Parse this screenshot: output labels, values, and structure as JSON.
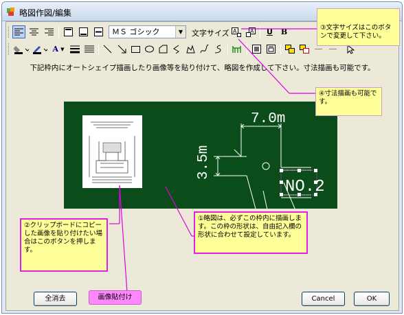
{
  "window": {
    "title": "略図作図/編集"
  },
  "toolbar": {
    "font_name": "ＭＳ ゴシック",
    "font_size_label": "文字サイズ",
    "underline_label": "U",
    "bold_label": "B",
    "text_color_label": "A"
  },
  "instruction": "下記枠内にオートシェイプ描画したり画像等を貼り付けて、略図を作成して下さい。寸法描画も可能です。",
  "canvas": {
    "dim_top": "7.0m",
    "dim_left": "3.5m",
    "no_label": "NO.2"
  },
  "notes": {
    "note1": "①略図は、必ずこの枠内に描画します。この枠の形状は、自由記入欄の形状に合わせて設定しています。",
    "note2": "②クリップボードにコピーした画像を貼り付けたい場合はこのボタンを押します。",
    "note3": "③文字サイズはこのボタンで変更して下さい。",
    "note4": "④寸法描画も可能です。"
  },
  "buttons": {
    "clear_all": "全消去",
    "paste_image": "画像貼付け",
    "cancel": "Cancel",
    "ok": "OK"
  }
}
